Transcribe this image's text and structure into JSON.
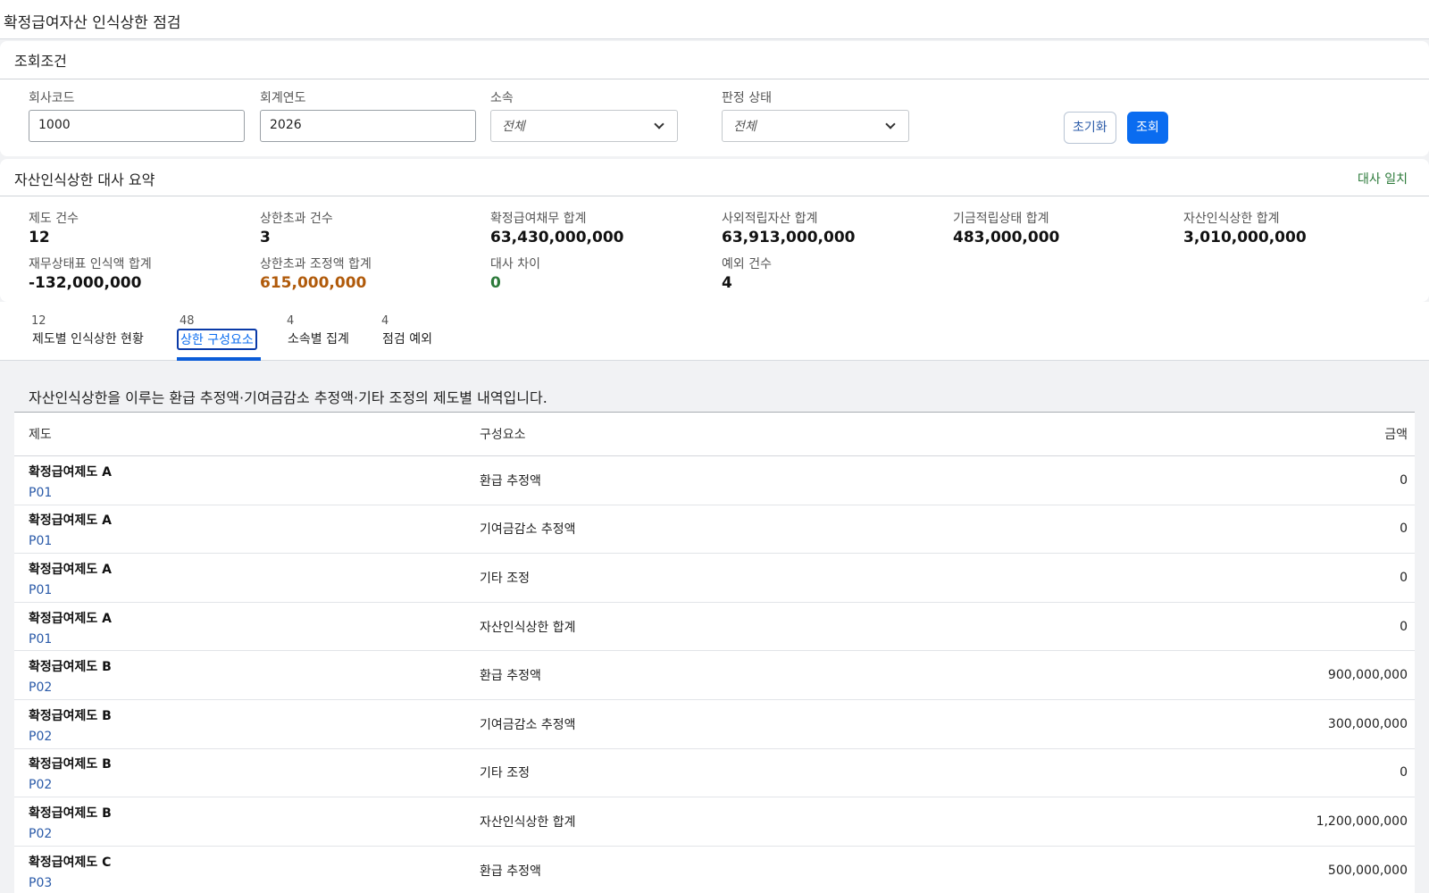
{
  "page": {
    "title": "확정급여자산 인식상한 점검"
  },
  "search": {
    "header": "조회조건",
    "fields": {
      "company_code": {
        "label": "회사코드",
        "value": "1000"
      },
      "fiscal_year": {
        "label": "회계연도",
        "value": "2026"
      },
      "affiliation": {
        "label": "소속",
        "value": "전체"
      },
      "judgment_status": {
        "label": "판정 상태",
        "value": "전체"
      }
    },
    "reset_label": "초기화",
    "search_label": "조회"
  },
  "summary": {
    "header": "자산인식상한 대사 요약",
    "status": "대사 일치",
    "metrics": {
      "plan_count": {
        "label": "제도 건수",
        "value": "12"
      },
      "over_limit_count": {
        "label": "상한초과 건수",
        "value": "3"
      },
      "dbo_total": {
        "label": "확정급여채무 합계",
        "value": "63,430,000,000"
      },
      "plan_assets_total": {
        "label": "사외적립자산 합계",
        "value": "63,913,000,000"
      },
      "funded_status_total": {
        "label": "기금적립상태 합계",
        "value": "483,000,000"
      },
      "asset_ceiling_total": {
        "label": "자산인식상한 합계",
        "value": "3,010,000,000"
      },
      "bs_recognized_total": {
        "label": "재무상태표 인식액 합계",
        "value": "-132,000,000"
      },
      "over_limit_adj_total": {
        "label": "상한초과 조정액 합계",
        "value": "615,000,000"
      },
      "recon_diff": {
        "label": "대사 차이",
        "value": "0"
      },
      "exception_count": {
        "label": "예외 건수",
        "value": "4"
      }
    },
    "colors": {
      "warning": "#b05a0a",
      "success": "#2c7a3a"
    }
  },
  "tabs": [
    {
      "count": "12",
      "label": "제도별 인식상한 현황"
    },
    {
      "count": "48",
      "label": "상한 구성요소"
    },
    {
      "count": "4",
      "label": "소속별 집계"
    },
    {
      "count": "4",
      "label": "점검 예외"
    }
  ],
  "content": {
    "description": "자산인식상한을 이루는 환급 추정액·기여금감소 추정액·기타 조정의 제도별 내역입니다.",
    "columns": {
      "plan": "제도",
      "component": "구성요소",
      "amount": "금액"
    },
    "rows": [
      {
        "plan": "확정급여제도 A",
        "code": "P01",
        "component": "환급 추정액",
        "amount": "0"
      },
      {
        "plan": "확정급여제도 A",
        "code": "P01",
        "component": "기여금감소 추정액",
        "amount": "0"
      },
      {
        "plan": "확정급여제도 A",
        "code": "P01",
        "component": "기타 조정",
        "amount": "0"
      },
      {
        "plan": "확정급여제도 A",
        "code": "P01",
        "component": "자산인식상한 합계",
        "amount": "0"
      },
      {
        "plan": "확정급여제도 B",
        "code": "P02",
        "component": "환급 추정액",
        "amount": "900,000,000"
      },
      {
        "plan": "확정급여제도 B",
        "code": "P02",
        "component": "기여금감소 추정액",
        "amount": "300,000,000"
      },
      {
        "plan": "확정급여제도 B",
        "code": "P02",
        "component": "기타 조정",
        "amount": "0"
      },
      {
        "plan": "확정급여제도 B",
        "code": "P02",
        "component": "자산인식상한 합계",
        "amount": "1,200,000,000"
      },
      {
        "plan": "확정급여제도 C",
        "code": "P03",
        "component": "환급 추정액",
        "amount": "500,000,000"
      }
    ]
  }
}
